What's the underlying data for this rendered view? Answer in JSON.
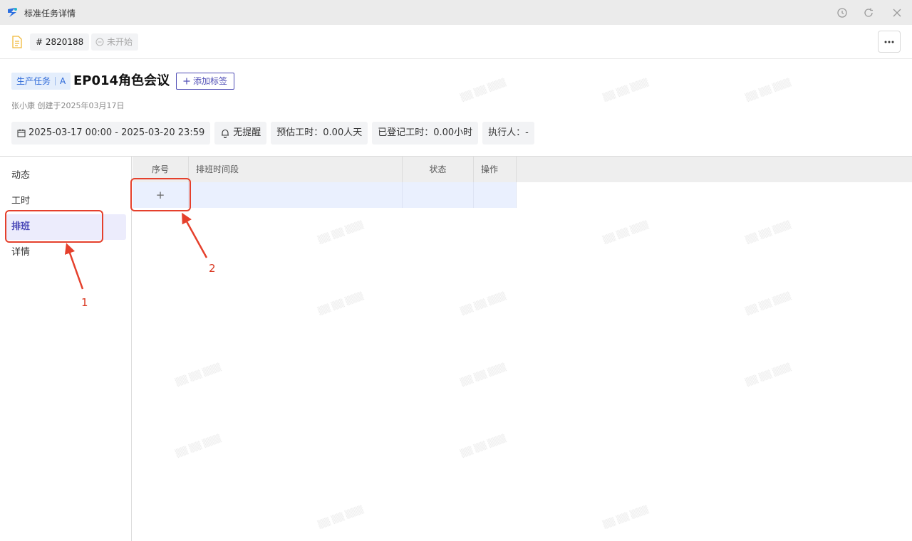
{
  "window": {
    "title": "标准任务详情"
  },
  "toolbar": {
    "task_id": "# 2820188",
    "status": "未开始"
  },
  "header": {
    "task_type": "生产任务",
    "task_level": "A",
    "title": "EP014角色会议",
    "add_tag_label": "添加标签",
    "creator_line": "张小康 创建于2025年03月17日"
  },
  "meta": {
    "date_range": "2025-03-17 00:00 - 2025-03-20 23:59",
    "reminder": "无提醒",
    "estimated_hours": "预估工时：0.00人天",
    "logged_hours": "已登记工时：0.00小时",
    "assignee": "执行人：-"
  },
  "sidebar": {
    "items": [
      {
        "label": "动态"
      },
      {
        "label": "工时"
      },
      {
        "label": "排班"
      },
      {
        "label": "详情"
      }
    ],
    "active": "排班"
  },
  "table": {
    "columns": [
      "序号",
      "排班时间段",
      "状态",
      "操作"
    ],
    "add_row_glyph": "+"
  },
  "annotations": {
    "labels": [
      "1",
      "2"
    ],
    "color": "#e5402c"
  },
  "colors": {
    "accent": "#4f4db5",
    "tag_blue": "#2c68d8",
    "active_bg": "#ececfc",
    "row_highlight": "#eaf0fe"
  }
}
